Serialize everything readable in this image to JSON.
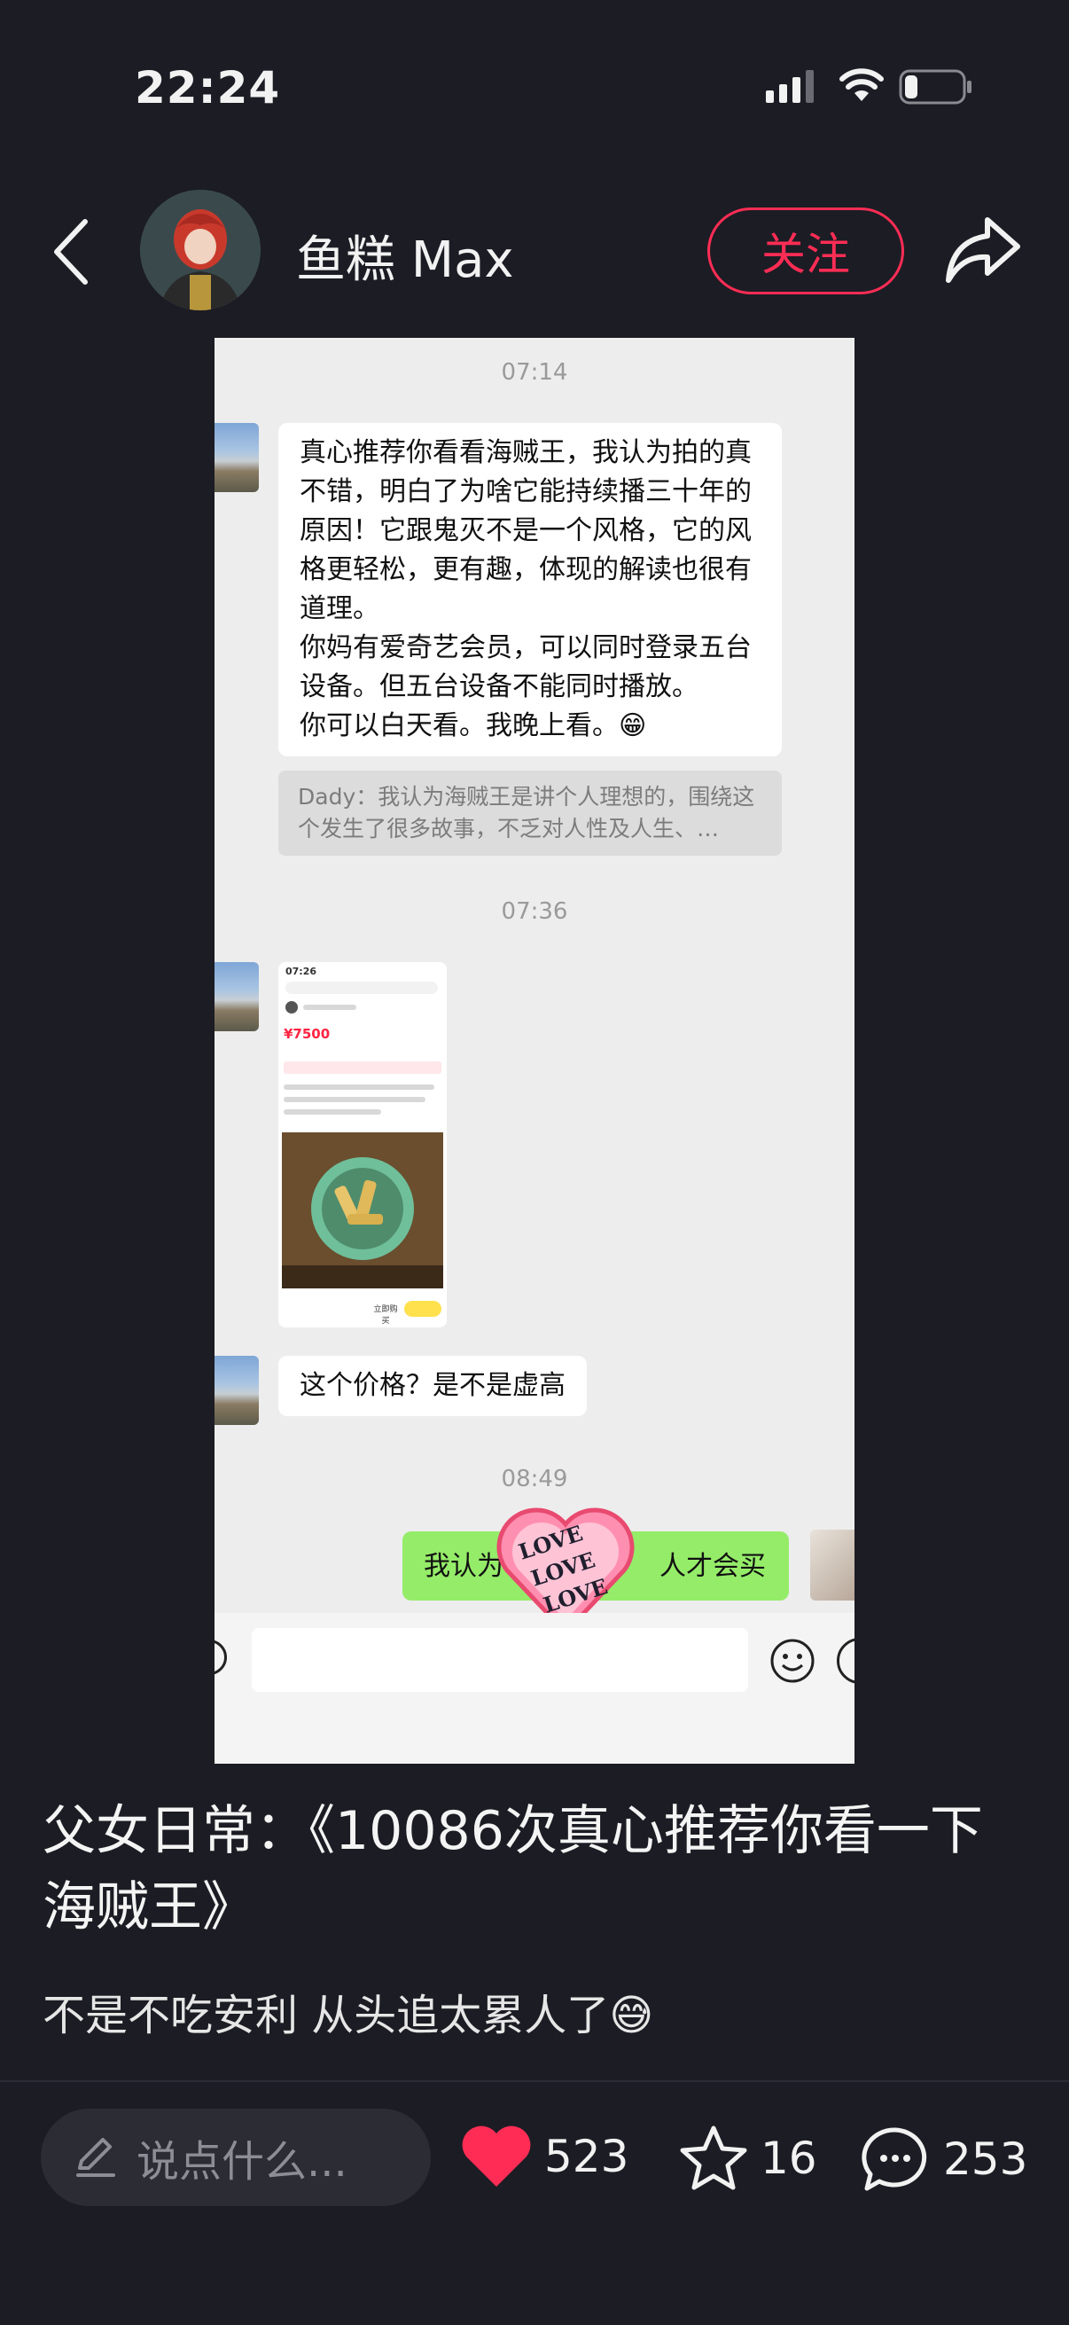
{
  "status_bar": {
    "time": "22:24"
  },
  "header": {
    "username": "鱼糕 Max",
    "follow_label": "关注"
  },
  "chat": {
    "timestamps": [
      "07:14",
      "07:36",
      "08:49"
    ],
    "message1": "真心推荐你看看海贼王，我认为拍的真不错，明白了为啥它能持续播三十年的原因！它跟鬼灭不是一个风格，它的风格更轻松，更有趣，体现的解读也很有道理。\n你妈有爱奇艺会员，可以同时登录五台设备。但五台设备不能同时播放。\n你可以白天看。我晚上看。😁",
    "quote": "Dady：我认为海贼王是讲个人理想的，围绕这个发生了很多故事，不乏对人性及人生、…",
    "mini_screenshot": {
      "time": "07:26",
      "price": "¥7500",
      "buy_label": "立即购买"
    },
    "message2": "这个价格？是不是虚高",
    "green_message_left": "我认为",
    "green_message_right": "人才会买",
    "sticker_text": [
      "LOVE",
      "LOVE",
      "LOVE"
    ]
  },
  "post": {
    "title": "父女日常：《10086次真心推荐你看一下海贼王》",
    "description": "不是不吃安利 从头追太累人了😅"
  },
  "bottom_bar": {
    "comment_placeholder": "说点什么...",
    "likes": "523",
    "stars": "16",
    "comments": "253"
  },
  "colors": {
    "background": "#1c1c24",
    "accent": "#ff2d55",
    "like": "#ff2d55",
    "chat_green": "#95ec69"
  }
}
